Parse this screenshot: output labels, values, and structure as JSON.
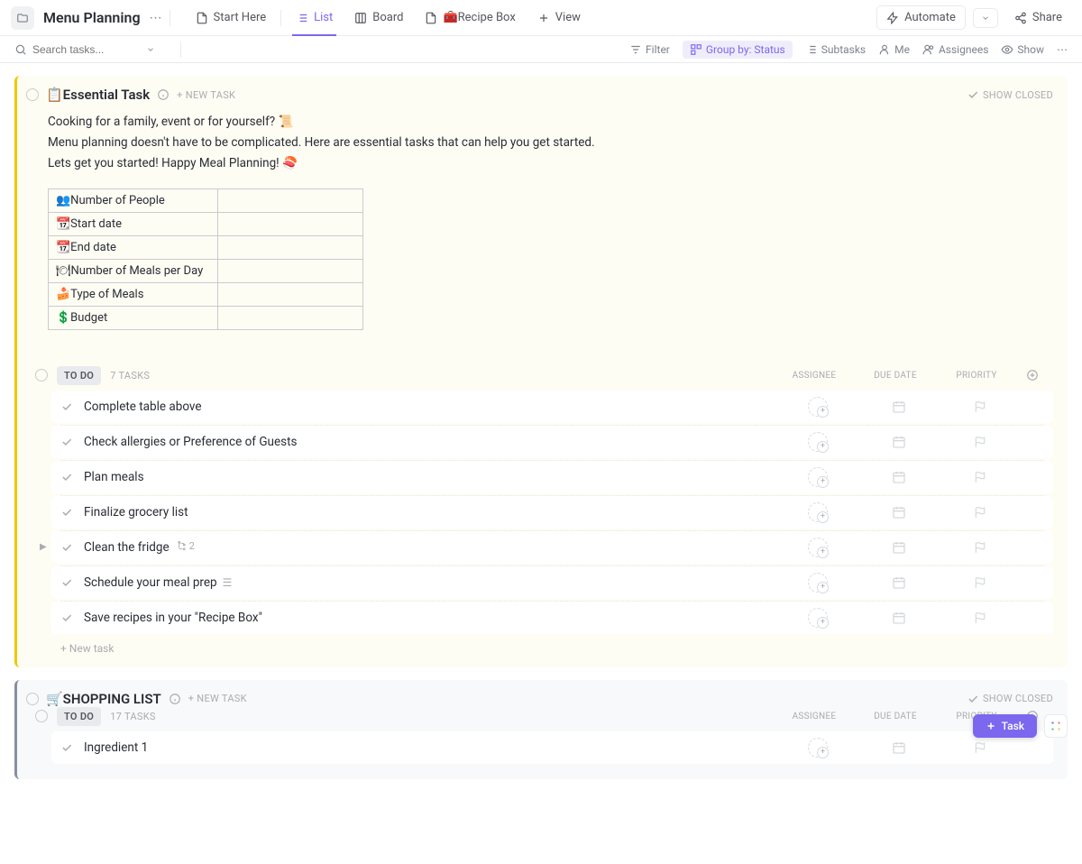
{
  "header": {
    "title": "Menu Planning",
    "views": [
      {
        "label": "Start Here",
        "icon": "doc"
      },
      {
        "label": "List",
        "icon": "list",
        "active": true
      },
      {
        "label": "Board",
        "icon": "board"
      },
      {
        "label": "🧰Recipe Box",
        "icon": "doc"
      },
      {
        "label": "View",
        "icon": "plus"
      }
    ],
    "automate": "Automate",
    "share": "Share"
  },
  "toolbar": {
    "search_placeholder": "Search tasks...",
    "filter": "Filter",
    "group_by": "Group by: Status",
    "subtasks": "Subtasks",
    "me": "Me",
    "assignees": "Assignees",
    "show": "Show"
  },
  "sections": [
    {
      "id": "essential",
      "title": "📋Essential Task",
      "new_task": "+ NEW TASK",
      "show_closed": "SHOW CLOSED",
      "description": [
        "Cooking for a family, event or for yourself? 📜",
        "Menu planning doesn't have to be complicated. Here are essential tasks that can help you get started.",
        "Lets get you started! Happy Meal Planning! 🍣"
      ],
      "table_rows": [
        "👥Number of People",
        "📆Start date",
        "📆End date",
        "🍽Number of Meals per Day",
        "🍰Type of Meals",
        "💲Budget"
      ],
      "status_label": "TO DO",
      "task_count": "7 TASKS",
      "columns": [
        "ASSIGNEE",
        "DUE DATE",
        "PRIORITY"
      ],
      "tasks": [
        {
          "name": "Complete table above"
        },
        {
          "name": "Check allergies or Preference of Guests"
        },
        {
          "name": "Plan meals"
        },
        {
          "name": "Finalize grocery list"
        },
        {
          "name": "Clean the fridge",
          "subtasks": 2,
          "expandable": true
        },
        {
          "name": "Schedule your meal prep",
          "has_desc": true
        },
        {
          "name": "Save recipes in your \"Recipe Box\""
        }
      ],
      "new_task_row": "+ New task"
    },
    {
      "id": "shopping",
      "title": "🛒SHOPPING LIST",
      "new_task": "+ NEW TASK",
      "show_closed": "SHOW CLOSED",
      "status_label": "TO DO",
      "task_count": "17 TASKS",
      "columns": [
        "ASSIGNEE",
        "DUE DATE",
        "PRIORITY"
      ],
      "tasks": [
        {
          "name": "Ingredient 1"
        }
      ]
    }
  ],
  "fab": "Task"
}
